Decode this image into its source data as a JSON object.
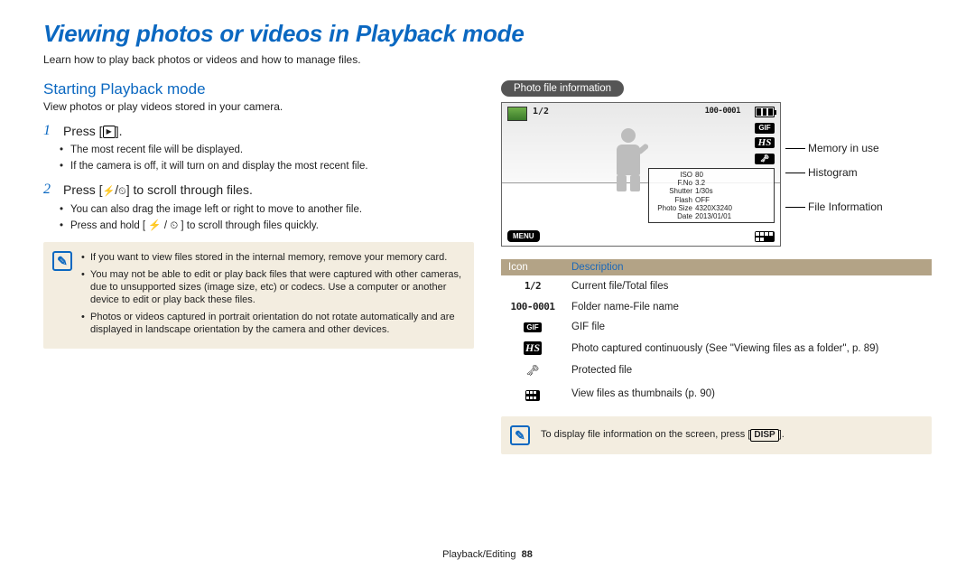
{
  "title": "Viewing photos or videos in Playback mode",
  "lead": "Learn how to play back photos or videos and how to manage files.",
  "left": {
    "h2": "Starting Playback mode",
    "desc": "View photos or play videos stored in your camera.",
    "step1_prefix": "Press [",
    "step1_suffix": "].",
    "step1_bullets": [
      "The most recent file will be displayed.",
      "If the camera is off, it will turn on and display the most recent file."
    ],
    "step2_prefix": "Press [",
    "step2_mid": "/",
    "step2_suffix": "] to scroll through files.",
    "step2_bullets": [
      "You can also drag the image left or right to move to another file.",
      "Press and hold [ ⚡ / ⏲ ] to scroll through files quickly."
    ],
    "notes": [
      "If you want to view files stored in the internal memory, remove your memory card.",
      "You may not be able to edit or play back files that were captured with other cameras, due to unsupported sizes (image size, etc) or codecs. Use a computer or another device to edit or play back these files.",
      "Photos or videos captured in portrait orientation do not rotate automatically and are displayed in landscape orientation by the camera and other devices."
    ]
  },
  "right": {
    "pill": "Photo file information",
    "callouts": {
      "memory": "Memory in use",
      "histogram": "Histogram",
      "fileinfo": "File Information"
    },
    "figure": {
      "counter": "1/2",
      "folder": "100-0001",
      "info_rows": [
        {
          "k": "ISO",
          "v": "80"
        },
        {
          "k": "F.No",
          "v": "3.2"
        },
        {
          "k": "Shutter",
          "v": "1/30s"
        },
        {
          "k": "Flash",
          "v": "OFF"
        },
        {
          "k": "Photo Size",
          "v": "4320X3240"
        },
        {
          "k": "Date",
          "v": "2013/01/01"
        }
      ],
      "menu": "MENU",
      "badges": {
        "gif": "GIF",
        "hs": "HS",
        "key": "🗝"
      }
    },
    "table": {
      "h_icon": "Icon",
      "h_desc": "Description",
      "rows": [
        {
          "icon_text": "1/2",
          "kind": "mono",
          "desc": "Current file/Total files"
        },
        {
          "icon_text": "100-0001",
          "kind": "mono",
          "desc": "Folder name-File name"
        },
        {
          "icon_text": "GIF",
          "kind": "chip",
          "desc": "GIF file"
        },
        {
          "icon_text": "HS",
          "kind": "chipit",
          "desc": "Photo captured continuously (See \"Viewing files as a folder\", p. 89)"
        },
        {
          "icon_text": "🗝",
          "kind": "key",
          "desc": "Protected file"
        },
        {
          "icon_text": "grid",
          "kind": "grid",
          "desc": "View files as thumbnails (p. 90)"
        }
      ]
    },
    "tip_prefix": "To display file information on the screen, press [",
    "tip_disp": "DISP",
    "tip_suffix": "]."
  },
  "footer": {
    "section": "Playback/Editing",
    "page": "88"
  }
}
